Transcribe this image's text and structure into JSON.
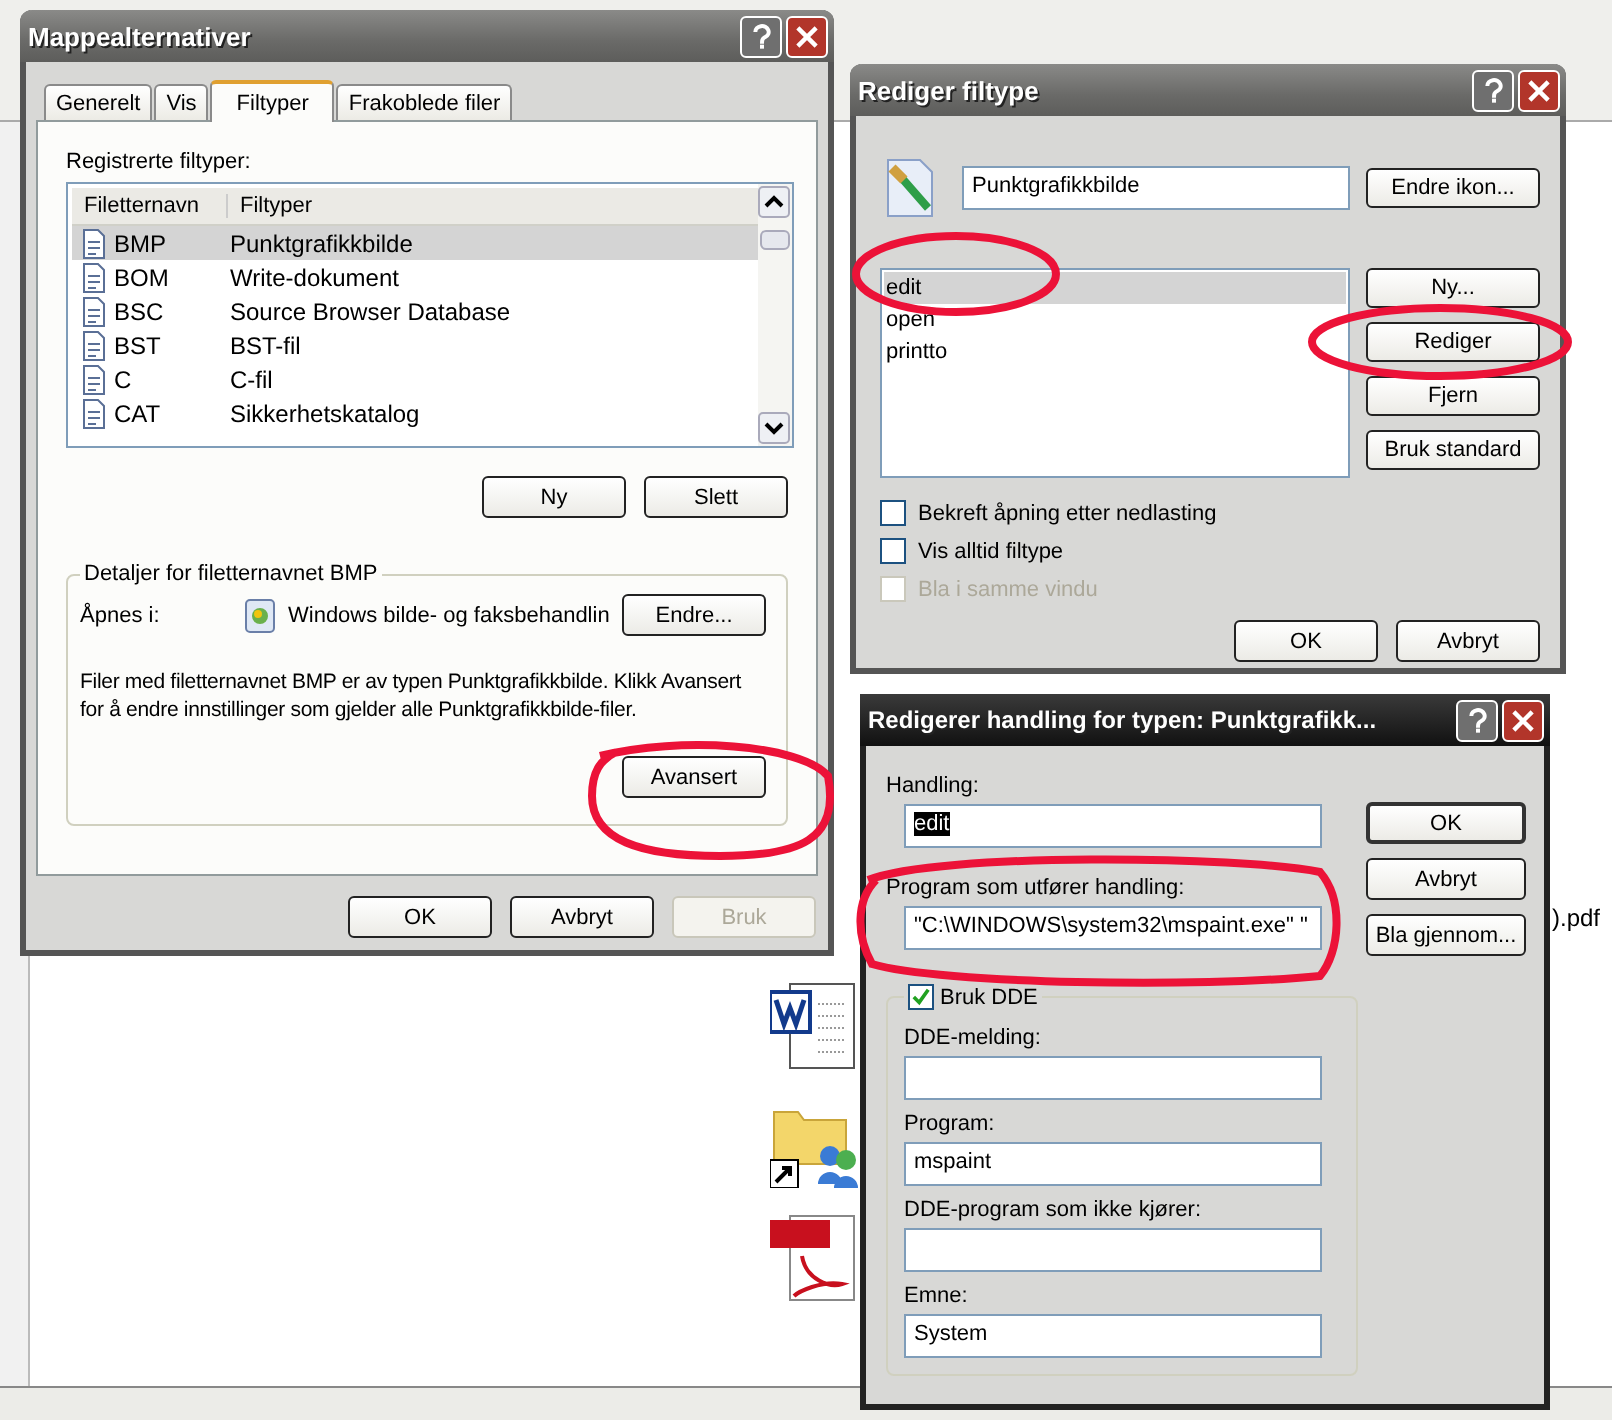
{
  "background": {
    "file_label": ").pdf"
  },
  "folder_options": {
    "title": "Mappealternativer",
    "active": false,
    "tabs": [
      {
        "label": "Generelt",
        "selected": false
      },
      {
        "label": "Vis",
        "selected": false
      },
      {
        "label": "Filtyper",
        "selected": true
      },
      {
        "label": "Frakoblede filer",
        "selected": false
      }
    ],
    "list_label": "Registrerte filtyper:",
    "columns": [
      "Filetternavn",
      "Filtyper"
    ],
    "rows": [
      {
        "extension": "BMP",
        "type": "Punktgrafikkbilde",
        "selected": true
      },
      {
        "extension": "BOM",
        "type": "Write-dokument",
        "selected": false
      },
      {
        "extension": "BSC",
        "type": "Source Browser Database",
        "selected": false
      },
      {
        "extension": "BST",
        "type": "BST-fil",
        "selected": false
      },
      {
        "extension": "C",
        "type": "C-fil",
        "selected": false
      },
      {
        "extension": "CAT",
        "type": "Sikkerhetskatalog",
        "selected": false
      }
    ],
    "list_buttons": [
      "Ny",
      "Slett"
    ],
    "details": {
      "legend": "Detaljer for filetternavnet BMP",
      "opens_label": "Åpnes i:",
      "opens_app": "Windows bilde- og faksbehandlin",
      "change_button": "Endre...",
      "description": "Filer med filetternavnet BMP er av typen Punktgrafikkbilde. Klikk Avansert for å endre innstillinger som gjelder alle Punktgrafikkbilde-filer.",
      "advanced_button": "Avansert"
    },
    "footer_buttons": [
      {
        "label": "OK",
        "disabled": false
      },
      {
        "label": "Avbryt",
        "disabled": false
      },
      {
        "label": "Bruk",
        "disabled": true
      }
    ]
  },
  "edit_file_type": {
    "title": "Rediger filtype",
    "active": false,
    "type_name": "Punktgrafikkbilde",
    "change_icon_button": "Endre ikon...",
    "actions": [
      {
        "label": "edit",
        "selected": true
      },
      {
        "label": "open",
        "selected": false
      },
      {
        "label": "printto",
        "selected": false
      }
    ],
    "action_buttons": [
      "Ny...",
      "Rediger",
      "Fjern",
      "Bruk standard"
    ],
    "options": [
      {
        "label": "Bekreft åpning etter nedlasting",
        "checked": false,
        "disabled": false
      },
      {
        "label": "Vis alltid filtype",
        "checked": false,
        "disabled": false
      },
      {
        "label": "Bla i samme vindu",
        "checked": false,
        "disabled": true
      }
    ],
    "footer_buttons": [
      "OK",
      "Avbryt"
    ]
  },
  "edit_action": {
    "title": "Redigerer handling for typen: Punktgrafikk...",
    "active": true,
    "action_label": "Handling:",
    "action_value": "edit",
    "action_value_selected": true,
    "program_label": "Program som utfører handling:",
    "program_value": "\"C:\\WINDOWS\\system32\\mspaint.exe\" \"",
    "buttons": [
      {
        "label": "OK",
        "default": true
      },
      {
        "label": "Avbryt",
        "default": false
      },
      {
        "label": "Bla gjennom...",
        "default": false
      }
    ],
    "dde": {
      "label": "Bruk DDE",
      "checked": true
    },
    "fields": [
      {
        "label": "DDE-melding:"
      },
      {
        "label": "Program:",
        "value": "mspaint"
      },
      {
        "label": "DDE-program som ikke kjører:"
      },
      {
        "label": "Emne:",
        "value": "System"
      }
    ]
  }
}
